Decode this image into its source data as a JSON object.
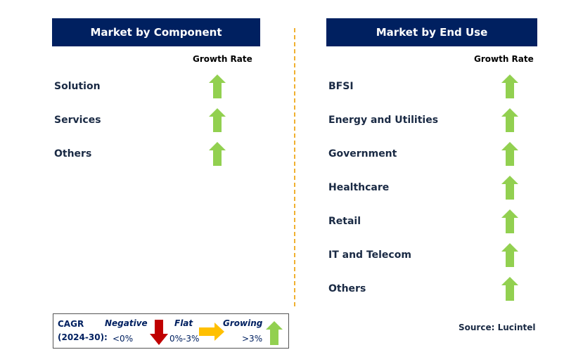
{
  "left": {
    "title": "Market by Component",
    "growth_label": "Growth Rate",
    "items": [
      {
        "label": "Solution",
        "trend": "growing"
      },
      {
        "label": "Services",
        "trend": "growing"
      },
      {
        "label": "Others",
        "trend": "growing"
      }
    ]
  },
  "right": {
    "title": "Market by End Use",
    "growth_label": "Growth Rate",
    "items": [
      {
        "label": "BFSI",
        "trend": "growing"
      },
      {
        "label": "Energy and Utilities",
        "trend": "growing"
      },
      {
        "label": "Government",
        "trend": "growing"
      },
      {
        "label": "Healthcare",
        "trend": "growing"
      },
      {
        "label": "Retail",
        "trend": "growing"
      },
      {
        "label": "IT and Telecom",
        "trend": "growing"
      },
      {
        "label": "Others",
        "trend": "growing"
      }
    ]
  },
  "legend": {
    "cagr": "CAGR",
    "period": "(2024-30):",
    "negative": "Negative",
    "negative_range": "<0%",
    "flat": "Flat",
    "flat_range": "0%-3%",
    "growing": "Growing",
    "growing_range": ">3%"
  },
  "source": "Source: Lucintel",
  "colors": {
    "header": "#002060",
    "growing": "#92D050",
    "flat": "#FFC000",
    "negative": "#C00000",
    "divider": "#F0B030"
  }
}
